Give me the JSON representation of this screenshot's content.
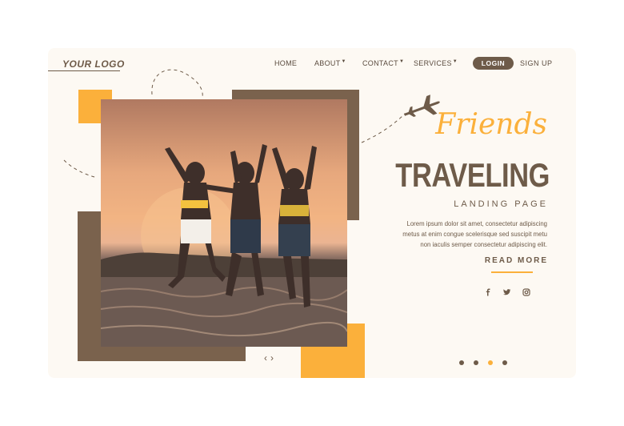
{
  "logo": "YOUR LOGO",
  "nav": {
    "items": [
      {
        "label": "HOME",
        "dropdown": false
      },
      {
        "label": "ABOUT",
        "dropdown": true
      },
      {
        "label": "CONTACT",
        "dropdown": true
      },
      {
        "label": "SERVICES",
        "dropdown": true
      }
    ],
    "login": "LOGIN",
    "signup": "SIGN UP"
  },
  "hero": {
    "script_title": "Friends",
    "title": "TRAVELING",
    "subtitle": "LANDING PAGE",
    "description_lines": [
      "Lorem ipsum dolor sit amet, consectetur adipiscing",
      "metus at enim congue scelerisque sed suscipit metu",
      "non iaculis semper consectetur adipiscing elit."
    ],
    "read_more": "READ MORE"
  },
  "socials": [
    "facebook-icon",
    "twitter-icon",
    "instagram-icon"
  ],
  "slider": {
    "prev": "‹",
    "next": "›",
    "dots": 4,
    "active_dot": 3
  },
  "colors": {
    "brown": "#6e5b49",
    "yellow": "#fbb03b",
    "background": "#fdf9f3"
  }
}
